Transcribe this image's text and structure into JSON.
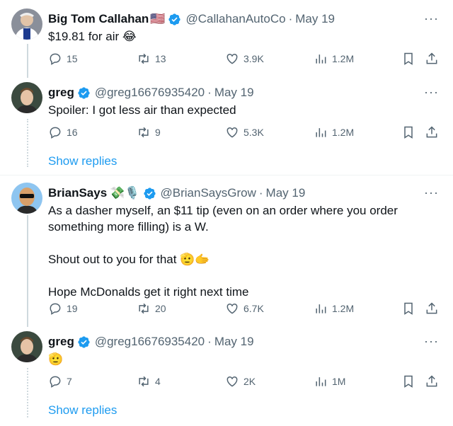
{
  "tweets": [
    {
      "name": "Big Tom Callahan",
      "flag": "🇺🇸",
      "handle": "@CallahanAutoCo",
      "date": "May 19",
      "text": [
        "$19.81 for air 😂"
      ],
      "replies": "15",
      "retweets": "13",
      "likes": "3.9K",
      "views": "1.2M"
    },
    {
      "name": "greg",
      "handle": "@greg16676935420",
      "date": "May 19",
      "text": [
        "Spoiler: I got less air than expected"
      ],
      "replies": "16",
      "retweets": "9",
      "likes": "5.3K",
      "views": "1.2M"
    },
    {
      "name": "BrianSays",
      "badges": "💸🎙️",
      "handle": "@BrianSaysGrow",
      "date": "May 19",
      "text": [
        "As a dasher myself, an $11 tip (even on an order where you order something more filling) is a W.",
        "",
        "Shout out to you for that 🫡🫱",
        "",
        "Hope McDonalds get it right next time"
      ],
      "replies": "19",
      "retweets": "20",
      "likes": "6.7K",
      "views": "1.2M"
    },
    {
      "name": "greg",
      "handle": "@greg16676935420",
      "date": "May 19",
      "text": [
        "🫡"
      ],
      "replies": "7",
      "retweets": "4",
      "likes": "2K",
      "views": "1M"
    }
  ],
  "show_replies_label": "Show replies",
  "more_label": "···",
  "dot_label": "·",
  "colors": {
    "verified": "#1d9bf0",
    "link": "#1d9bf0",
    "muted": "#536471"
  }
}
